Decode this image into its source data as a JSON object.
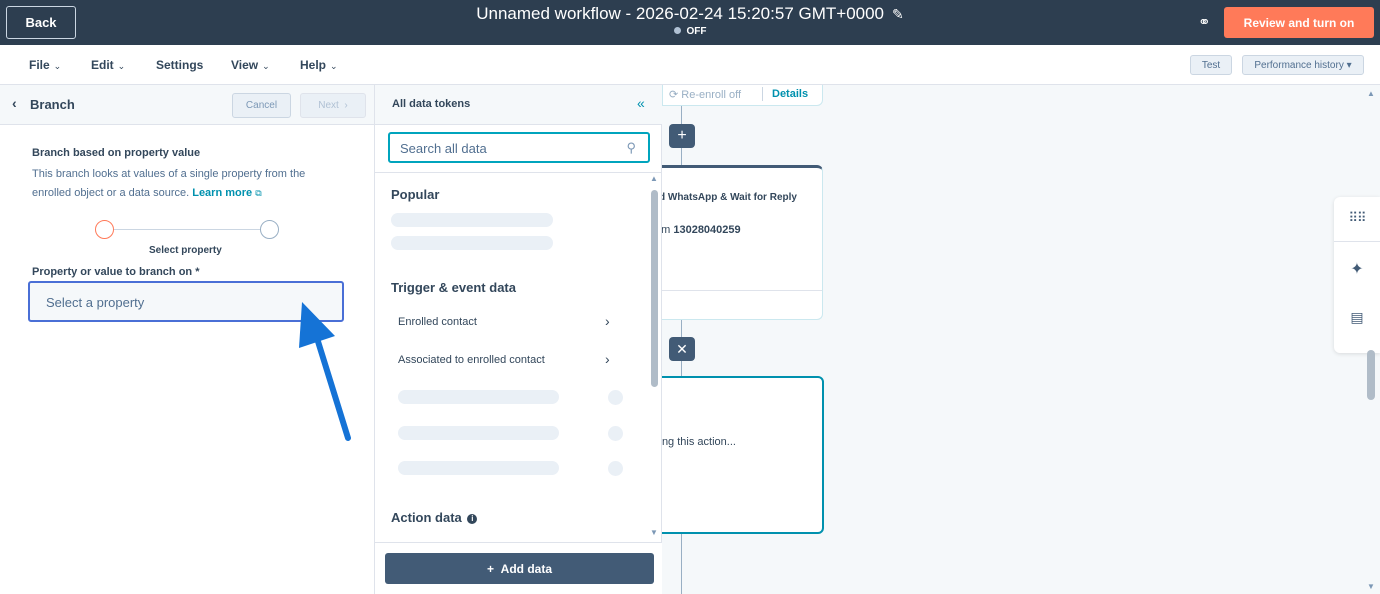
{
  "topbar": {
    "back_label": "Back",
    "title": "Unnamed workflow - 2026-02-24 15:20:57 GMT+0000",
    "status": "OFF",
    "review_label": "Review and turn on"
  },
  "menu": {
    "file": "File",
    "edit": "Edit",
    "settings": "Settings",
    "view": "View",
    "help": "Help",
    "test": "Test",
    "performance_history": "Performance history"
  },
  "branch_panel": {
    "title": "Branch",
    "cancel": "Cancel",
    "next": "Next",
    "heading": "Branch based on property value",
    "description": "This branch looks at values of a single property from the enrolled object or a data source.",
    "learn_more": "Learn more",
    "step_label": "Select property",
    "property_label": "Property or value to branch on *",
    "property_placeholder": "Select a property"
  },
  "tokens_panel": {
    "title": "All data tokens",
    "search_placeholder": "Search all data",
    "popular": "Popular",
    "trigger_event_data": "Trigger & event data",
    "items": [
      "Enrolled contact",
      "Associated to enrolled contact"
    ],
    "action_data": "Action data",
    "add_data": "Add data"
  },
  "canvas": {
    "reenroll": "Re-enroll off",
    "details": "Details",
    "node_title": "d WhatsApp & Wait for Reply",
    "node_subtitle_prefix": "om",
    "node_phone": "13028040259",
    "action_text": "iting this action..."
  },
  "colors": {
    "topbar_bg": "#2d3e50",
    "primary_orange": "#ff7a59",
    "teal_accent": "#0091ae",
    "annotation_arrow": "#1573d6"
  }
}
